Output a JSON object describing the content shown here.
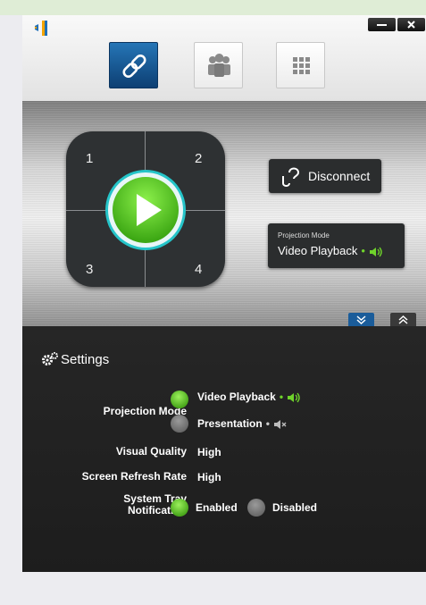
{
  "header": {
    "logo_icon": "projector-app-logo-icon",
    "window_controls": {
      "minimize_icon": "minimize-icon",
      "close_icon": "close-icon"
    },
    "tabs": [
      {
        "icon": "link-icon",
        "active": true
      },
      {
        "icon": "group-users-icon",
        "active": false
      },
      {
        "icon": "grid-icon",
        "active": false
      }
    ]
  },
  "control": {
    "quadrants": [
      "1",
      "2",
      "3",
      "4"
    ],
    "play_icon": "play-icon",
    "disconnect_label": "Disconnect",
    "projection_mode_caption": "Projection Mode",
    "projection_mode_value": "Video Playback",
    "collapse_icons": [
      "chevron-double-down-icon",
      "chevron-double-up-icon"
    ]
  },
  "settings": {
    "title": "Settings",
    "projection_mode_label": "Projection Mode",
    "projection_options": [
      {
        "label": "Video Playback",
        "selected": true,
        "icon": "speaker-on-icon"
      },
      {
        "label": "Presentation",
        "selected": false,
        "icon": "speaker-muted-icon"
      }
    ],
    "visual_quality_label": "Visual Quality",
    "visual_quality_value": "High",
    "refresh_rate_label": "Screen Refresh Rate",
    "refresh_rate_value": "High",
    "tray_label_line1": "System Tray",
    "tray_label_line2": "Notification",
    "tray_options": [
      {
        "label": "Enabled",
        "selected": true
      },
      {
        "label": "Disabled",
        "selected": false
      }
    ]
  },
  "colors": {
    "accent_green": "#6fd32b",
    "active_tab_blue": "#1a5c9a",
    "ring_cyan": "#25c4c9"
  }
}
